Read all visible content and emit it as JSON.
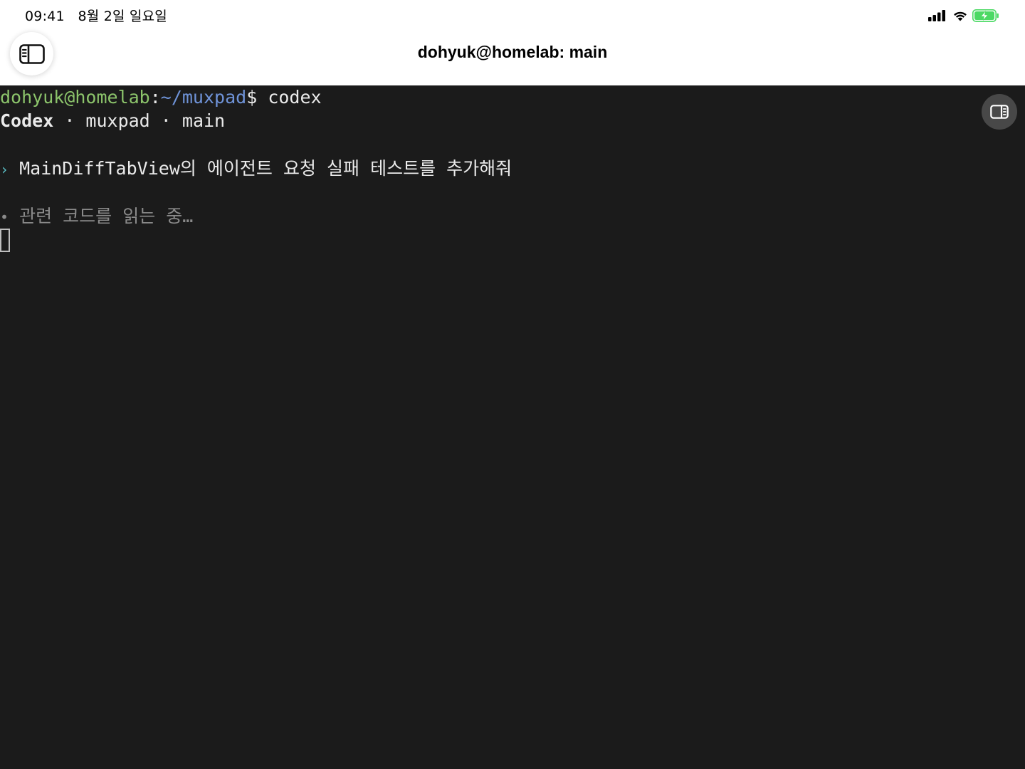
{
  "status_bar": {
    "time": "09:41",
    "date": "8월 2일 일요일",
    "icons": [
      "cellular-signal-icon",
      "wifi-icon",
      "battery-charging-icon"
    ],
    "battery_color": "#4cd964"
  },
  "header": {
    "title": "dohyuk@homelab: main",
    "sidebar_toggle_icon": "sidebar-icon"
  },
  "terminal": {
    "prompt": {
      "user_host": "dohyuk@homelab",
      "separator": ":",
      "path": "~/muxpad",
      "symbol": "$",
      "command": " codex"
    },
    "session_info": {
      "app": "Codex",
      "sep1": " · ",
      "repo": "muxpad",
      "sep2": " · ",
      "branch": "main"
    },
    "user_message": {
      "marker": "›",
      "text": " MainDiffTabView의 에이전트 요청 실패 테스트를 추가해줘"
    },
    "status_line": {
      "marker": "•",
      "text": " 관련 코드를 읽는 중…"
    },
    "panel_toggle_icon": "inspector-panel-icon",
    "colors": {
      "background": "#1b1b1b",
      "user_host": "#8cc46b",
      "path": "#6f93d8",
      "dim": "#8a8a8a",
      "arrow": "#5bc0c7"
    }
  }
}
